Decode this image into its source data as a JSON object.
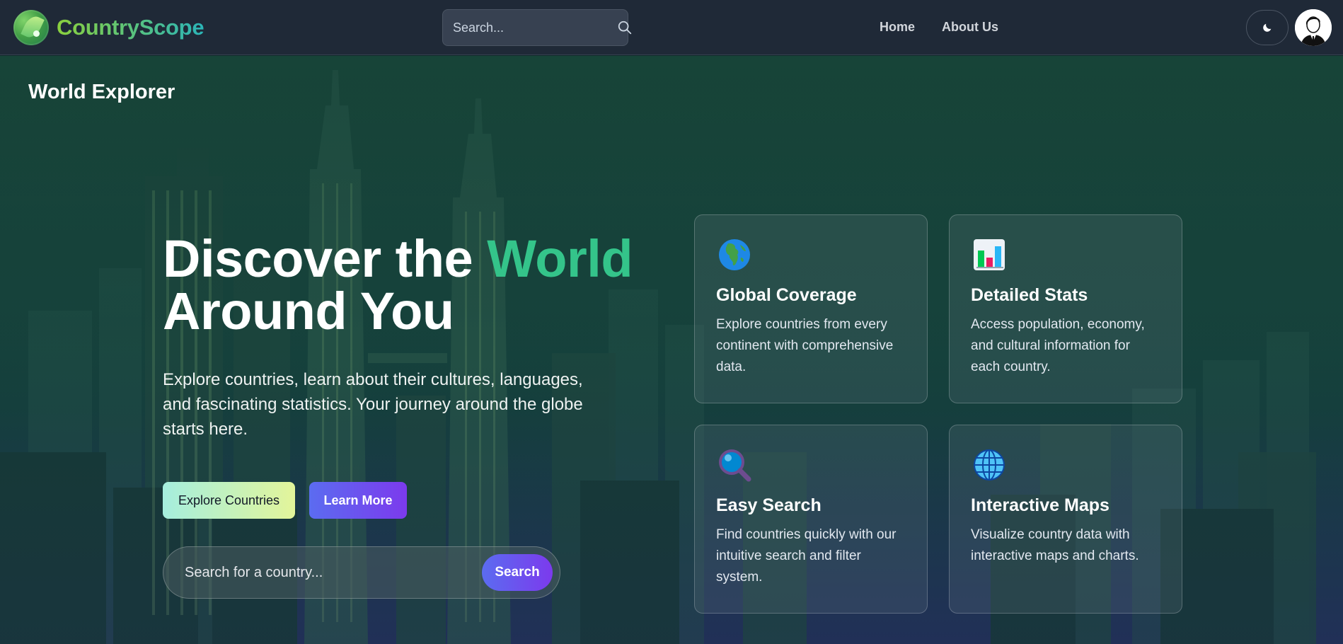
{
  "navbar": {
    "brand": "CountryScope",
    "search_placeholder": "Search...",
    "links": [
      {
        "label": "Home"
      },
      {
        "label": "About Us"
      }
    ]
  },
  "hero": {
    "page_label": "World Explorer",
    "title_part1": "Discover the",
    "title_accent": "World",
    "title_part2": "Around You",
    "subtitle": "Explore countries, learn about their cultures, languages, and fascinating statistics. Your journey around the globe starts here.",
    "buttons": {
      "explore": "Explore Countries",
      "learn": "Learn More"
    },
    "search": {
      "placeholder": "Search for a country...",
      "button": "Search"
    }
  },
  "features": [
    {
      "icon": "globe-africa-icon",
      "title": "Global Coverage",
      "text": "Explore countries from every continent with comprehensive data."
    },
    {
      "icon": "bar-chart-icon",
      "title": "Detailed Stats",
      "text": "Access population, economy, and cultural information for each country."
    },
    {
      "icon": "magnifier-icon",
      "title": "Easy Search",
      "text": "Find countries quickly with our intuitive search and filter system."
    },
    {
      "icon": "globe-meridians-icon",
      "title": "Interactive Maps",
      "text": "Visualize country data with interactive maps and charts."
    }
  ],
  "colors": {
    "accent_green": "#34c48a",
    "brand_gradient_start": "#8bd13e",
    "brand_gradient_end": "#2bb5b8",
    "primary_button": "#6d4ef0",
    "navbar_bg": "#1f2937"
  }
}
